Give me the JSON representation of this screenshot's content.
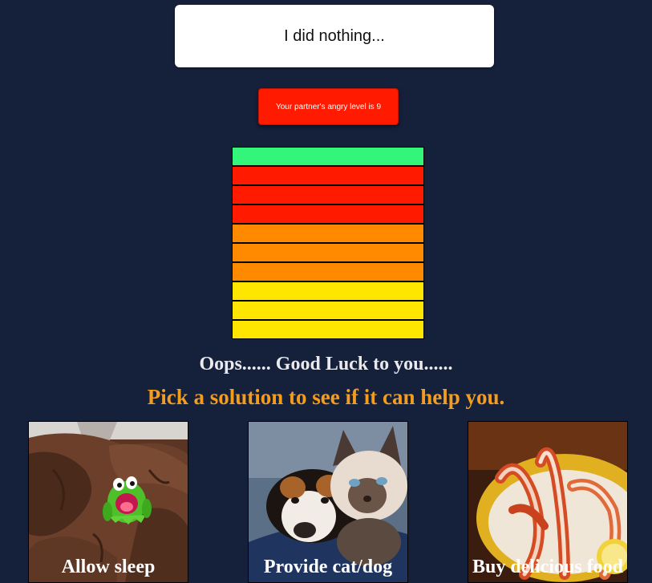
{
  "message": {
    "text": "I did nothing..."
  },
  "angry_button": {
    "label": "Your partner's angry level is 9"
  },
  "meter": {
    "level": 9,
    "max": 10,
    "colors": [
      "#33f57a",
      "#ff1a00",
      "#ff1a00",
      "#ff1a00",
      "#ff8a00",
      "#ff8a00",
      "#ff8a00",
      "#ffe600",
      "#ffe600",
      "#ffe600"
    ]
  },
  "headline": "Oops...... Good Luck to you......",
  "prompt": "Pick a solution to see if it can help you.",
  "solutions": [
    {
      "label": "Allow sleep",
      "image": "frog-in-bed"
    },
    {
      "label": "Provide cat/dog",
      "image": "cat-and-dog"
    },
    {
      "label": "Buy delicious food",
      "image": "crab-legs"
    }
  ],
  "colors": {
    "background": "#15203b",
    "accent": "#f39c1e",
    "button": "#ff1a00"
  }
}
